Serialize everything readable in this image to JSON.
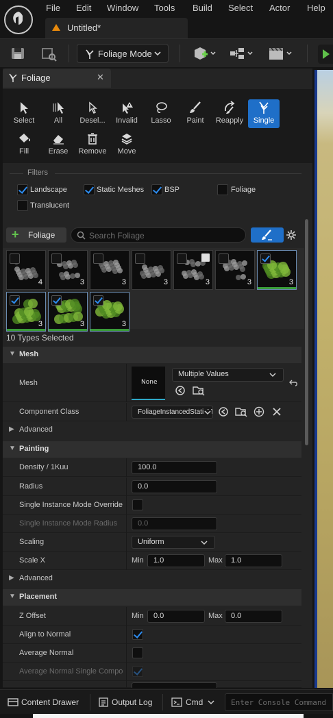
{
  "menu": [
    "File",
    "Edit",
    "Window",
    "Tools",
    "Build",
    "Select",
    "Actor",
    "Help"
  ],
  "doc_tab": "Untitled*",
  "mode_button": "Foliage Mode",
  "panel_title": "Foliage",
  "tools": [
    {
      "label": "Select",
      "icon": "cursor-icon"
    },
    {
      "label": "All",
      "icon": "select-all-icon"
    },
    {
      "label": "Desel...",
      "icon": "deselect-icon"
    },
    {
      "label": "Invalid",
      "icon": "invalid-icon"
    },
    {
      "label": "Lasso",
      "icon": "lasso-icon"
    },
    {
      "label": "Paint",
      "icon": "brush-icon"
    },
    {
      "label": "Reapply",
      "icon": "reapply-icon"
    },
    {
      "label": "Single",
      "icon": "single-icon"
    },
    {
      "label": "Fill",
      "icon": "fill-icon"
    },
    {
      "label": "Erase",
      "icon": "erase-icon"
    },
    {
      "label": "Remove",
      "icon": "trash-icon"
    },
    {
      "label": "Move",
      "icon": "move-icon"
    }
  ],
  "filters": {
    "title": "Filters",
    "items": [
      {
        "label": "Landscape",
        "checked": true
      },
      {
        "label": "Static Meshes",
        "checked": true
      },
      {
        "label": "BSP",
        "checked": true
      },
      {
        "label": "Foliage",
        "checked": false
      },
      {
        "label": "Translucent",
        "checked": false
      }
    ]
  },
  "add_foliage": "Foliage",
  "search_placeholder": "Search Foliage",
  "foliage_types": [
    {
      "count": "4",
      "checked": false
    },
    {
      "count": "3",
      "checked": false
    },
    {
      "count": "3",
      "checked": false
    },
    {
      "count": "3",
      "checked": false
    },
    {
      "count": "3",
      "checked": false
    },
    {
      "count": "3",
      "checked": false
    },
    {
      "count": "3",
      "checked": true
    },
    {
      "count": "3",
      "checked": true
    },
    {
      "count": "3",
      "checked": true
    },
    {
      "count": "3",
      "checked": true
    }
  ],
  "types_selected": "10 Types Selected",
  "sections": {
    "mesh": "Mesh",
    "painting": "Painting",
    "placement": "Placement"
  },
  "props": {
    "mesh_label": "Mesh",
    "mesh_thumb": "None",
    "mesh_value": "Multiple Values",
    "component_class_label": "Component Class",
    "component_class_value": "FoliageInstancedStaticMeshComponent",
    "advanced": "Advanced",
    "density_label": "Density / 1Kuu",
    "density_value": "100.0",
    "radius_label": "Radius",
    "radius_value": "0.0",
    "single_mode_override_label": "Single Instance Mode Override Radius",
    "single_mode_radius_label": "Single Instance Mode Radius",
    "single_mode_radius_value": "0.0",
    "scaling_label": "Scaling",
    "scaling_value": "Uniform",
    "scale_x_label": "Scale X",
    "min": "Min",
    "max": "Max",
    "scale_x_min": "1.0",
    "scale_x_max": "1.0",
    "z_offset_label": "Z Offset",
    "z_offset_min": "0.0",
    "z_offset_max": "0.0",
    "align_to_normal_label": "Align to Normal",
    "average_normal_label": "Average Normal",
    "average_normal_single_label": "Average Normal Single Component"
  },
  "statusbar": {
    "content_drawer": "Content Drawer",
    "output_log": "Output Log",
    "cmd": "Cmd",
    "console_placeholder": "Enter Console Command"
  },
  "colors": {
    "accent": "#1f6fc8",
    "check": "#2d8cf0",
    "add_green": "#63c44e"
  }
}
